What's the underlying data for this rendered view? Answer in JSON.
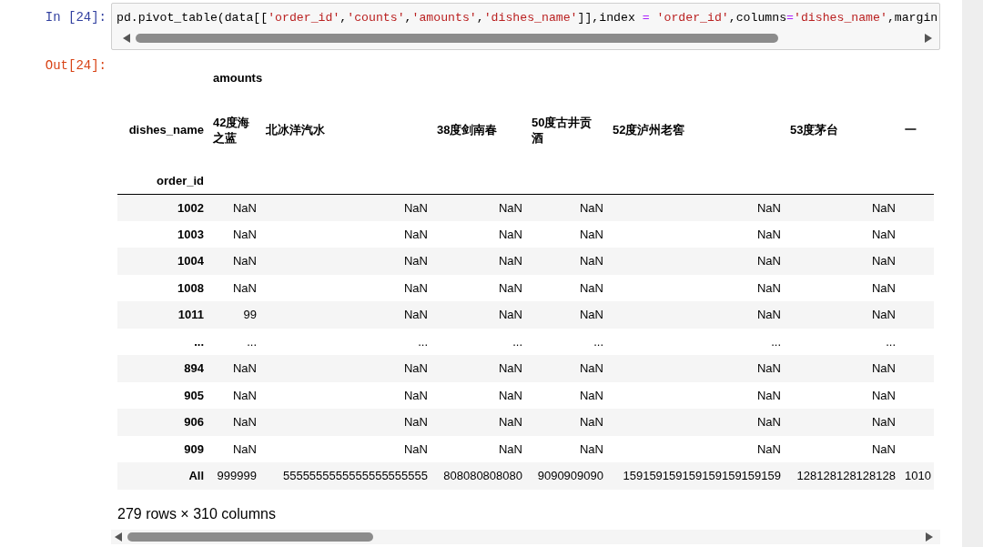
{
  "input_cell": {
    "prompt": "In [24]:",
    "code": [
      {
        "kind": "plain",
        "text": "pd.pivot_table(data[["
      },
      {
        "kind": "string",
        "text": "'order_id'"
      },
      {
        "kind": "plain",
        "text": ","
      },
      {
        "kind": "string",
        "text": "'counts'"
      },
      {
        "kind": "plain",
        "text": ","
      },
      {
        "kind": "string",
        "text": "'amounts'"
      },
      {
        "kind": "plain",
        "text": ","
      },
      {
        "kind": "string",
        "text": "'dishes_name'"
      },
      {
        "kind": "plain",
        "text": "]],index "
      },
      {
        "kind": "operator",
        "text": "= "
      },
      {
        "kind": "string",
        "text": "'order_id'"
      },
      {
        "kind": "plain",
        "text": ",columns"
      },
      {
        "kind": "operator",
        "text": "="
      },
      {
        "kind": "string",
        "text": "'dishes_name'"
      },
      {
        "kind": "plain",
        "text": ",margin"
      }
    ]
  },
  "output_cell": {
    "prompt": "Out[24]:",
    "table": {
      "values_label": "amounts",
      "columns_name": "dishes_name",
      "index_name": "order_id",
      "columns": [
        "42度海之蓝",
        "北冰洋汽水",
        "38度剑南春",
        "50度古井贡酒",
        "52度泸州老窖",
        "53度茅台",
        "一"
      ],
      "rows": [
        {
          "index": "1002",
          "cells": [
            "NaN",
            "NaN",
            "NaN",
            "NaN",
            "NaN",
            "NaN"
          ]
        },
        {
          "index": "1003",
          "cells": [
            "NaN",
            "NaN",
            "NaN",
            "NaN",
            "NaN",
            "NaN"
          ]
        },
        {
          "index": "1004",
          "cells": [
            "NaN",
            "NaN",
            "NaN",
            "NaN",
            "NaN",
            "NaN"
          ]
        },
        {
          "index": "1008",
          "cells": [
            "NaN",
            "NaN",
            "NaN",
            "NaN",
            "NaN",
            "NaN"
          ]
        },
        {
          "index": "1011",
          "cells": [
            "99",
            "NaN",
            "NaN",
            "NaN",
            "NaN",
            "NaN"
          ]
        },
        {
          "index": "...",
          "cells": [
            "...",
            "...",
            "...",
            "...",
            "...",
            "..."
          ]
        },
        {
          "index": "894",
          "cells": [
            "NaN",
            "NaN",
            "NaN",
            "NaN",
            "NaN",
            "NaN"
          ]
        },
        {
          "index": "905",
          "cells": [
            "NaN",
            "NaN",
            "NaN",
            "NaN",
            "NaN",
            "NaN"
          ]
        },
        {
          "index": "906",
          "cells": [
            "NaN",
            "NaN",
            "NaN",
            "NaN",
            "NaN",
            "NaN"
          ]
        },
        {
          "index": "909",
          "cells": [
            "NaN",
            "NaN",
            "NaN",
            "NaN",
            "NaN",
            "NaN"
          ]
        },
        {
          "index": "All",
          "cells": [
            "999999",
            "5555555555555555555555",
            "808080808080",
            "9090909090",
            "159159159159159159159159",
            "128128128128128",
            "1010"
          ]
        }
      ],
      "shape": "279 rows × 310 columns"
    }
  }
}
